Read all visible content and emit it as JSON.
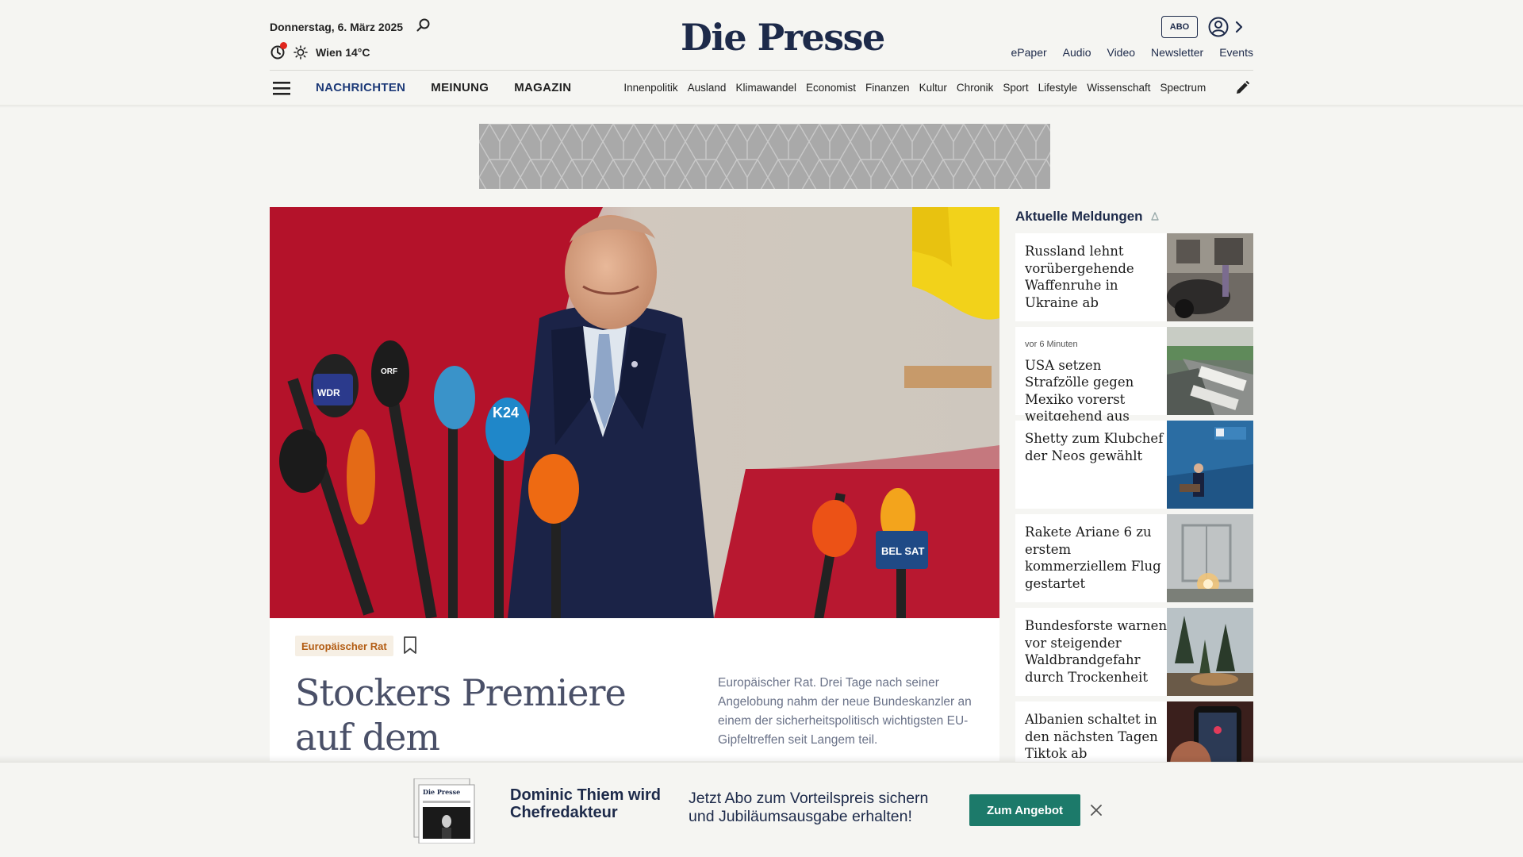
{
  "header": {
    "date": "Donnerstag, 6. März 2025",
    "weather": "Wien 14°C",
    "logo": "Die Presse",
    "abo_label": "ABO",
    "links": [
      "ePaper",
      "Audio",
      "Video",
      "Newsletter",
      "Events"
    ]
  },
  "nav": {
    "main": [
      "NACHRICHTEN",
      "MEINUNG",
      "MAGAZIN"
    ],
    "active": "NACHRICHTEN",
    "sub": [
      "Innenpolitik",
      "Ausland",
      "Klimawandel",
      "Economist",
      "Finanzen",
      "Kultur",
      "Chronik",
      "Sport",
      "Lifestyle",
      "Wissenschaft",
      "Spectrum"
    ]
  },
  "hero": {
    "mic_labels": [
      "WDR",
      "ORF",
      "K24",
      "BEL SAT"
    ],
    "category": "Europäischer Rat",
    "headline": "Stockers Premiere auf dem",
    "teaser": "Europäischer Rat. Drei Tage nach seiner Angelobung nahm der neue Bundeskanzler an einem der sicherheitspolitisch wichtigsten EU-Gipfeltreffen seit Langem teil."
  },
  "sidebar": {
    "title": "Aktuelle Meldungen",
    "items": [
      {
        "time": "",
        "title": "Russland lehnt vorübergehende Waffenruhe in Ukraine ab"
      },
      {
        "time": "vor 6 Minuten",
        "title": "USA setzen Strafzölle gegen Mexiko vorerst weitgehend aus"
      },
      {
        "time": "",
        "title": "Shetty zum Klubchef der Neos gewählt"
      },
      {
        "time": "",
        "title": "Rakete Ariane 6 zu erstem kommerziellem Flug gestartet"
      },
      {
        "time": "",
        "title": "Bundesforste warnen vor steigender Waldbrandgefahr durch Trockenheit"
      },
      {
        "time": "",
        "title": "Albanien schaltet in den nächsten Tagen Tiktok ab"
      }
    ]
  },
  "banner": {
    "paper_logo": "Die Presse",
    "headline": "Dominic Thiem wird Chefredakteur",
    "text": "Jetzt Abo zum Vorteilspreis sichern und Jubiläumsausgabe erhalten!",
    "button": "Zum Angebot"
  },
  "colors": {
    "brand_navy": "#1d2a4a",
    "nav_active": "#1d3a78",
    "category_text": "#b35d14",
    "category_bg": "#f6efe4",
    "offer_button": "#1c7a6a",
    "alert_dot": "#e0261d"
  },
  "icons": [
    "search-icon",
    "clock-icon",
    "sun-icon",
    "user-icon",
    "chevron-right-icon",
    "menu-icon",
    "pencil-icon",
    "bookmark-icon",
    "pulse-icon",
    "close-icon"
  ]
}
